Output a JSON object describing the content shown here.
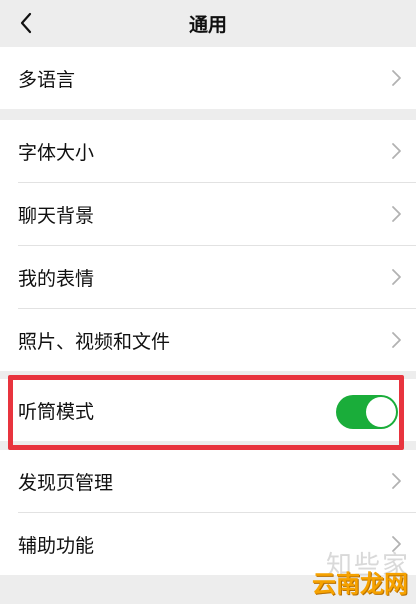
{
  "nav": {
    "title": "通用",
    "back_icon": "chevron-left-icon"
  },
  "groups": [
    {
      "items": [
        {
          "label": "多语言",
          "type": "link"
        }
      ]
    },
    {
      "items": [
        {
          "label": "字体大小",
          "type": "link"
        },
        {
          "label": "聊天背景",
          "type": "link"
        },
        {
          "label": "我的表情",
          "type": "link"
        },
        {
          "label": "照片、视频和文件",
          "type": "link"
        }
      ]
    },
    {
      "items": [
        {
          "label": "听筒模式",
          "type": "toggle",
          "on": true
        }
      ]
    },
    {
      "items": [
        {
          "label": "发现页管理",
          "type": "link"
        },
        {
          "label": "辅助功能",
          "type": "link"
        }
      ]
    }
  ],
  "toggle_color": "#1aad3a",
  "highlight_color": "#e8343e",
  "watermark": {
    "top": "知些家",
    "bottom": "云南龙网"
  }
}
